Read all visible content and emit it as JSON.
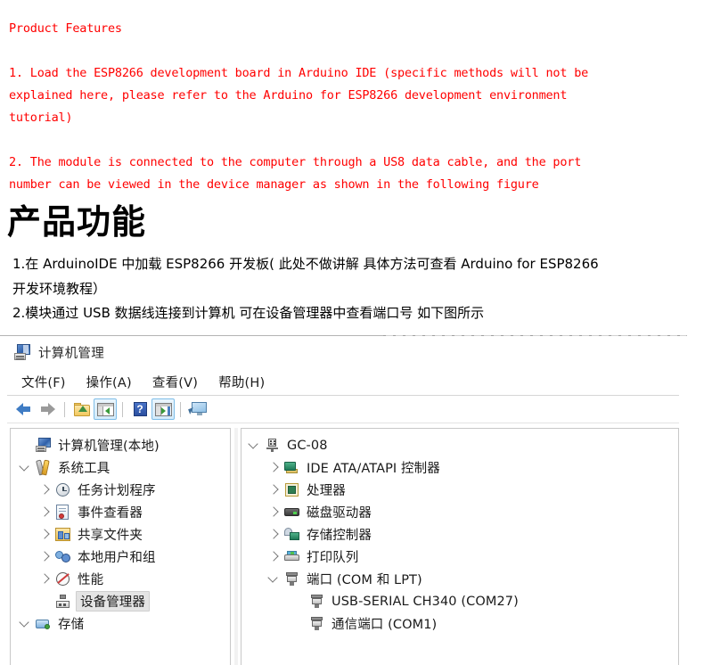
{
  "document": {
    "heading_en": "Product Features",
    "items_en": [
      "1. Load the ESP8266 development board in Arduino IDE (specific methods will not be",
      "explained here, please refer to the Arduino for ESP8266 development environment",
      "tutorial)",
      "2. The module is connected to the computer through a US8 data cable, and the port",
      "number can be viewed in the device manager as shown in the following figure"
    ],
    "heading_cn": "产品功能",
    "items_cn": [
      "1.在 ArduinoIDE 中加载 ESP8266 开发板( 此处不做讲解  具体方法可查看 Arduino for ESP8266",
      "开发环境教程）",
      "2.模块通过 USB 数据线连接到计算机  可在设备管理器中查看端口号  如下图所示"
    ],
    "accent_red": "#ff0000"
  },
  "window": {
    "title": "计算机管理",
    "title_icon": "computer-management-icon",
    "menu": [
      {
        "label": "文件(F)",
        "name": "file"
      },
      {
        "label": "操作(A)",
        "name": "action"
      },
      {
        "label": "查看(V)",
        "name": "view"
      },
      {
        "label": "帮助(H)",
        "name": "help"
      }
    ],
    "toolbar": [
      {
        "icon": "back-arrow-icon",
        "selected": false
      },
      {
        "icon": "forward-arrow-icon",
        "selected": false
      },
      {
        "icon": "separator",
        "selected": false
      },
      {
        "icon": "folder-up-icon",
        "selected": false
      },
      {
        "icon": "show-hide-console-tree-icon",
        "selected": true
      },
      {
        "icon": "separator",
        "selected": false
      },
      {
        "icon": "help-icon",
        "selected": false
      },
      {
        "icon": "show-hide-action-pane-icon",
        "selected": true
      },
      {
        "icon": "separator",
        "selected": false
      },
      {
        "icon": "monitor-icon",
        "selected": false
      }
    ]
  },
  "console_tree": {
    "nodes": [
      {
        "label": "计算机管理(本地)",
        "icon": "computer-management-icon",
        "indent": 0,
        "toggle": "none",
        "selected": false
      },
      {
        "label": "系统工具",
        "icon": "system-tools-icon",
        "indent": 0,
        "toggle": "expanded",
        "selected": false
      },
      {
        "label": "任务计划程序",
        "icon": "task-scheduler-icon",
        "indent": 1,
        "toggle": "collapsed",
        "selected": false
      },
      {
        "label": "事件查看器",
        "icon": "event-viewer-icon",
        "indent": 1,
        "toggle": "collapsed",
        "selected": false
      },
      {
        "label": "共享文件夹",
        "icon": "shared-folders-icon",
        "indent": 1,
        "toggle": "collapsed",
        "selected": false
      },
      {
        "label": "本地用户和组",
        "icon": "local-users-groups-icon",
        "indent": 1,
        "toggle": "collapsed",
        "selected": false
      },
      {
        "label": "性能",
        "icon": "performance-icon",
        "indent": 1,
        "toggle": "collapsed",
        "selected": false
      },
      {
        "label": "设备管理器",
        "icon": "device-manager-icon",
        "indent": 1,
        "toggle": "none",
        "selected": true
      },
      {
        "label": "存储",
        "icon": "storage-icon",
        "indent": 0,
        "toggle": "expanded",
        "selected": false
      }
    ]
  },
  "device_tree": {
    "nodes": [
      {
        "label": "GC-08",
        "icon": "computer-icon",
        "indent": 0,
        "toggle": "expanded"
      },
      {
        "label": "IDE ATA/ATAPI 控制器",
        "icon": "ide-controller-icon",
        "indent": 1,
        "toggle": "collapsed"
      },
      {
        "label": "处理器",
        "icon": "processor-icon",
        "indent": 1,
        "toggle": "collapsed"
      },
      {
        "label": "磁盘驱动器",
        "icon": "disk-drive-icon",
        "indent": 1,
        "toggle": "collapsed"
      },
      {
        "label": "存储控制器",
        "icon": "storage-controller-icon",
        "indent": 1,
        "toggle": "collapsed"
      },
      {
        "label": "打印队列",
        "icon": "print-queue-icon",
        "indent": 1,
        "toggle": "collapsed"
      },
      {
        "label": "端口 (COM 和 LPT)",
        "icon": "ports-icon",
        "indent": 1,
        "toggle": "expanded"
      },
      {
        "label": "USB-SERIAL CH340 (COM27)",
        "icon": "port-device-icon",
        "indent": 2,
        "toggle": "none"
      },
      {
        "label": "通信端口 (COM1)",
        "icon": "port-device-icon",
        "indent": 2,
        "toggle": "none"
      }
    ]
  }
}
